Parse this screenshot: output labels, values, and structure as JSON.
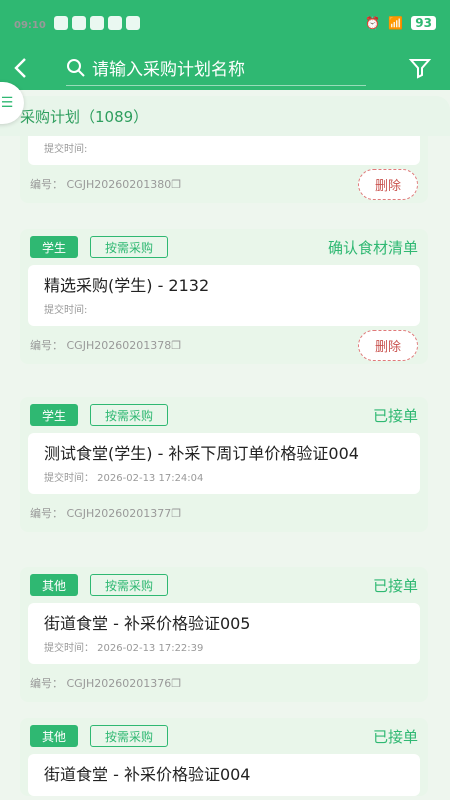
{
  "statusbar": {
    "time": "09:10",
    "battery": "93"
  },
  "search": {
    "placeholder": "请输入采购计划名称"
  },
  "subheader": {
    "title": "采购计划（1089）"
  },
  "cards": [
    {
      "time": "提交时间:",
      "code": "编号： CGJH20260201380",
      "del": "删除"
    },
    {
      "tag": "学生",
      "tag2": "按需采购",
      "status": "确认食材清单",
      "title": "精选采购(学生) - 2132",
      "time": "提交时间:",
      "code": "编号： CGJH20260201378",
      "del": "删除"
    },
    {
      "tag": "学生",
      "tag2": "按需采购",
      "status": "已接单",
      "title": "测试食堂(学生) - 补采下周订单价格验证004",
      "time": "提交时间： 2026-02-13 17:24:04",
      "code": "编号： CGJH20260201377"
    },
    {
      "tag": "其他",
      "tag2": "按需采购",
      "status": "已接单",
      "title": "街道食堂 - 补采价格验证005",
      "time": "提交时间： 2026-02-13 17:22:39",
      "code": "编号： CGJH20260201376"
    },
    {
      "tag": "其他",
      "tag2": "按需采购",
      "status": "已接单",
      "title": "街道食堂 - 补采价格验证004"
    }
  ]
}
